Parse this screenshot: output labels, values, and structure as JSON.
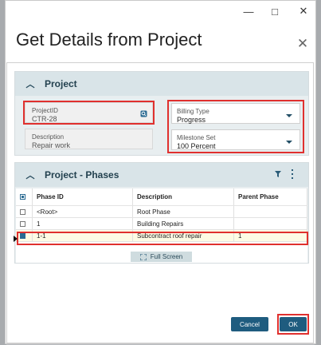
{
  "window": {
    "minimize_glyph": "—",
    "maximize_glyph": "□",
    "close_glyph": "✕"
  },
  "dialog": {
    "title": "Get Details from Project",
    "close_glyph": "✕"
  },
  "project_panel": {
    "title": "Project",
    "project_id": {
      "label": "ProjectID",
      "value": "CTR-28"
    },
    "description": {
      "label": "Description",
      "value": "Repair work"
    },
    "billing_type": {
      "label": "Billing Type",
      "value": "Progress"
    },
    "milestone_set": {
      "label": "Milestone Set",
      "value": "100 Percent"
    }
  },
  "phases_panel": {
    "title": "Project - Phases",
    "columns": [
      "Phase ID",
      "Description",
      "Parent Phase"
    ],
    "rows": [
      {
        "phase_id": "<Root>",
        "description": "Root Phase",
        "parent": "",
        "checked": false
      },
      {
        "phase_id": "1",
        "description": "Building Repairs",
        "parent": "",
        "checked": false
      },
      {
        "phase_id": "1-1",
        "description": "Subcontract roof repair",
        "parent": "1",
        "checked": true
      }
    ],
    "fullscreen_label": "Full Screen"
  },
  "footer": {
    "cancel_label": "Cancel",
    "ok_label": "OK"
  },
  "colors": {
    "primary_button": "#1f5c7f",
    "highlight_border": "#e0302e",
    "selected_row": "#fdfbe4"
  }
}
